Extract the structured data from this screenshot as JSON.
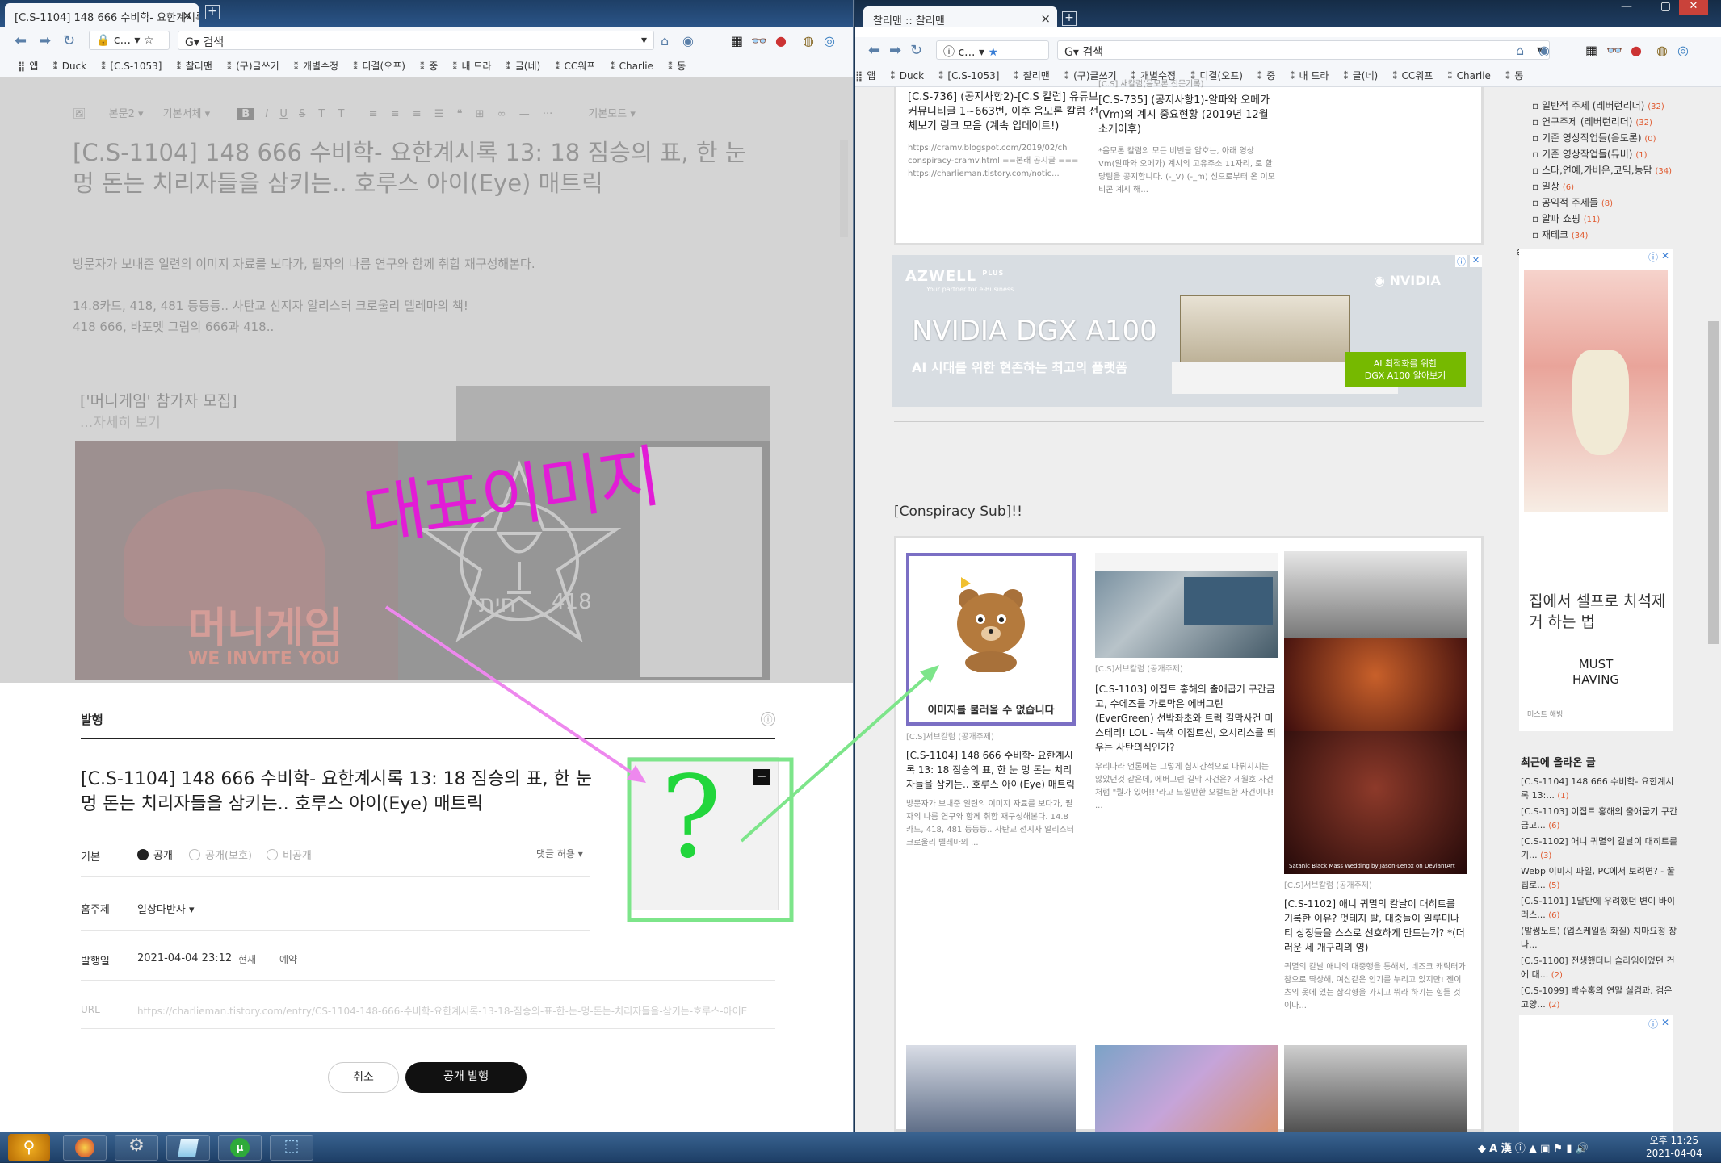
{
  "left": {
    "tab_title": "[C.S-1104] 148 666 수비학- 요한계시록",
    "new_tab": "+",
    "close": "×",
    "address": "c...",
    "search_placeholder": "검색",
    "bookmarks": [
      "앱",
      "Duck",
      "[C.S-1053]",
      "찰리맨",
      "(구)글쓰기",
      "개별수정",
      "디결(오프)",
      "중",
      "내 드라",
      "글(네)",
      "CC워프",
      "Charlie",
      "동"
    ],
    "editor": {
      "toolbar": {
        "style": "본문2",
        "font": "기본서체",
        "more": "···",
        "mode": "기본모드"
      },
      "title": "[C.S-1104] 148 666 수비학- 요한계시록 13: 18 짐승의 표, 한 눈 멍 돈는 치리자들을 삼키는.. 호루스 아이(Eye) 매트릭",
      "para1": "방문자가 보내준 일련의 이미지 자료를 보다가, 필자의 나름 연구와 함께 취합 재구성해본다.",
      "para2": "14.8카드, 418, 481 등등등.. 사탄교 선지자 알리스터 크로울리 텔레마의 책!",
      "para3": "418 666, 바포멧 그림의 666과 418..",
      "embed_title": "['머니게임' 참가자 모집]",
      "embed_more": "...자세히 보기",
      "poster_text": "머니게임",
      "poster_sub": "WE INVITE YOU",
      "hebrew": "חית",
      "num418": "418"
    },
    "annotation": {
      "handwritten": "대표이미지",
      "question": "?"
    },
    "dialog": {
      "heading": "발행",
      "title": "[C.S-1104] 148 666 수비학- 요한계시록 13: 18 짐승의 표, 한 눈 멍 돈는 치리자들을 삼키는.. 호루스 아이(Eye) 매트릭",
      "visibility_label": "기본",
      "options": [
        "공개",
        "공개(보호)",
        "비공개"
      ],
      "comment": "댓글 허용",
      "topic_label": "홈주제",
      "topic_value": "일상다반사",
      "date_label": "발행일",
      "date_value": "2021-04-04 23:12",
      "date_now": "현재",
      "date_reserve": "예약",
      "url_label": "URL",
      "url_value": "https://charlieman.tistory.com/entry/CS-1104-148-666-수비학-요한계시록-13-18-짐승의-표-한-눈-멍-돈는-치리자들을-삼키는-호루스-아이E",
      "cancel": "취소",
      "publish": "공개 발행",
      "thumb_minus": "−"
    }
  },
  "right": {
    "tab_title": "찰리맨 :: 찰리맨",
    "new_tab": "+",
    "close": "×",
    "address": "c...",
    "search_placeholder": "검색",
    "bookmarks": [
      "앱",
      "Duck",
      "[C.S-1053]",
      "찰리맨",
      "(구)글쓰기",
      "개별수정",
      "디결(오프)",
      "중",
      "내 드라",
      "글(네)",
      "CC워프",
      "Charlie",
      "동"
    ],
    "top_posts": [
      {
        "title": "[C.S-736] (공지사항2)-[C.S 칼럼] 유튜브 커뮤니티글 1~663번, 이후 음모론 칼럼 전체보기 링크 모음 (계속 업데이트!)",
        "body": "https://cramv.blogspot.com/2019/02/ch conspiracy-cramv.html ==본래 공지글 === https://charlieman.tistory.com/notic..."
      },
      {
        "cat": "[C.S] 새칼럼(음모론 전문기록)",
        "title": "[C.S-735] (공지사항1)-알파와 오메가(Vm)의 계시 중요현황 (2019년 12월 소개이후)",
        "body": "*음모론 칼럼의 모든 비번글 암호는, 아래 영상 Vm(알파와 오메가) 계시의 고유주소 11자리, 로 할당팀을 공지합니다. (-_V) (-_m) 신으로부터 온 이모티콘 계시 해..."
      }
    ],
    "ad": {
      "brand": "AZWELL",
      "brand_sup": "PLUS",
      "brand_sub": "Your partner for e-Business",
      "nvidia": "NVIDIA",
      "headline": "NVIDIA DGX A100",
      "sub": "AI 시대를 위한 현존하는 최고의 플랫폼",
      "cta": "AI 최적화를 위한\nDGX A100 알아보기",
      "info": "ⓘ",
      "x": "✕"
    },
    "section_title": "[Conspiracy Sub]!!",
    "posts": [
      {
        "placeholder": "이미지를 불러올 수 없습니다",
        "cat": "[C.S]서브칼럼 (공개주제)",
        "title": "[C.S-1104] 148 666 수비학- 요한계시록 13: 18 짐승의 표, 한 눈 멍 돈는 치리자들을 삼키는.. 호루스 아이(Eye) 매트릭",
        "body": "방문자가 보내준 일련의 이미지 자료를 보다가, 필자의 나름 연구와 함께 취합 재구성해본다. 14.8카드, 418, 481 등등등.. 사탄교 선지자 알리스터 크로울리 텔레마의 ..."
      },
      {
        "cat": "[C.S]서브칼럼 (공개주제)",
        "title": "[C.S-1103] 이집트 홍해의 출애굽기 구간금고, 수에즈를 가로막은 에버그린(EverGreen) 선박좌초와 트럭 길막사건 미스테리! LOL - 녹색 이집트신, 오시리스를 띄우는 사탄의식인가?",
        "body": "우리나라 언론에는 그렇게 심시간적으로 다뤄지지는 않았던것 같은데, 에버그린 길막 사건은? 세월호 사건처럼 \"뭘가 있어!!\"라고 느낄만한 오컬트한 사건이다! ..."
      },
      {
        "cat": "[C.S]서브칼럼 (공개주제)",
        "title": "[C.S-1102] 애니 귀멸의 칼날이 대히트를 기록한 이유? 멋테지 탈, 대중들이 일루미나티 상징들을 스스로 선호하게 만드는가? *(더러운 세 개구리의 영)",
        "body": "귀멸의 칼날 애니의 대중행을 통해서, 네즈코 캐릭터가 참으로 딱상해, 여신같은 인기를 누리고 있지만! 젠이츠의 옷에 있는 삼각형을 가지고 뭐라 하기는 힘들 것이다...",
        "cap": "Satanic Black Mass Wedding by Jason-Lenox on DeviantArt"
      }
    ],
    "sidebar": {
      "categories": [
        {
          "label": "일반적 주제 (레버런리더)",
          "count": "(32)"
        },
        {
          "label": "연구주제 (레버런리더)",
          "count": "(32)"
        },
        {
          "label": "기준 영상작업들(음모론)",
          "count": "(0)"
        },
        {
          "label": "기준 영상작업들(뮤비)",
          "count": "(1)"
        },
        {
          "label": "스타,연예,가버운,코믹,농담",
          "count": "(34)"
        },
        {
          "label": "일상",
          "count": "(6)"
        },
        {
          "label": "공익적 주제들",
          "count": "(8)"
        },
        {
          "label": "알파 쇼핑",
          "count": "(11)"
        },
        {
          "label": "재테크",
          "count": "(34)"
        }
      ],
      "ad_text": "집에서 셀프로 치석제거 하는 법",
      "must": "MUST\nHAVING",
      "must_sub": "머스트 해빙",
      "recent_title": "최근에 올라온 글",
      "recent": [
        {
          "label": "[C.S-1104] 148 666 수비학- 요한계시록 13:...",
          "count": "(1)"
        },
        {
          "label": "[C.S-1103] 이집트 홍해의 출애굽기 구간금고...",
          "count": "(6)"
        },
        {
          "label": "[C.S-1102] 애니 귀멸의 칼날이 대히트를 기...",
          "count": "(3)"
        },
        {
          "label": "Webp 이미지 파일, PC에서 보려면? - 꿀팁로...",
          "count": "(5)"
        },
        {
          "label": "[C.S-1101] 1달만에 우려했던 변이 바이러스...",
          "count": "(6)"
        },
        {
          "label": "(발썽노트) (업스케일링 화질) 치마요정 장나...",
          "count": ""
        },
        {
          "label": "[C.S-1100] 전생했더니 슬라임이었던 건에 대...",
          "count": "(2)"
        },
        {
          "label": "[C.S-1099] 박수홍의 연말 실검과, 검은 고양...",
          "count": "(2)"
        }
      ]
    }
  },
  "taskbar": {
    "time": "오후 11:25",
    "date": "2021-04-04",
    "ime": "A 漢"
  }
}
